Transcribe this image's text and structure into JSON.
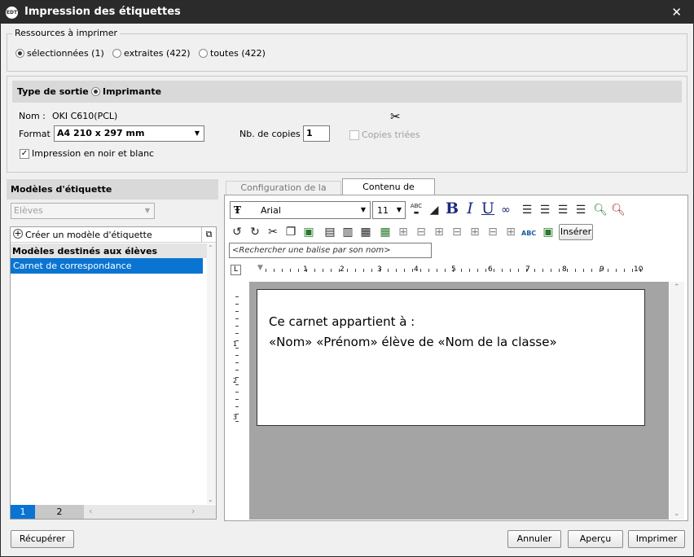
{
  "window": {
    "app_badge": "EDT",
    "title": "Impression des étiquettes"
  },
  "resources": {
    "legend": "Ressources à imprimer",
    "options": [
      "sélectionnées (1)",
      "extraites (422)",
      "toutes (422)"
    ],
    "selected_index": 0
  },
  "output": {
    "label": "Type de sortie :",
    "type": "Imprimante",
    "name_label": "Nom :",
    "name_value": "OKI C610(PCL)",
    "format_label": "Format :",
    "format_value": "A4 210 x 297 mm",
    "copies_label": "Nb. de copies :",
    "copies_value": "1",
    "sorted_label": "Copies triées",
    "bw_label": "Impression en noir et blanc",
    "bw_checked": true
  },
  "models": {
    "header": "Modèles d'étiquette",
    "category": "Elèves",
    "create_label": "Créer un modèle d'étiquette",
    "group_header": "Modèles destinés aux élèves",
    "items": [
      "Carnet de correspondance"
    ],
    "pages": [
      "1",
      "2"
    ]
  },
  "tabs": [
    "Configuration de la planche",
    "Contenu de l'étiquette"
  ],
  "editor": {
    "font": "Arial",
    "size": "11",
    "insert_label": "Insérer",
    "search_placeholder": "<Rechercher une balise par son nom>",
    "ruler_numbers": [
      "1",
      "2",
      "3",
      "4",
      "5",
      "6",
      "7",
      "8",
      "9",
      "10"
    ],
    "vruler_numbers": [
      "1",
      "2",
      "3"
    ],
    "line1": "Ce carnet appartient à :",
    "line2": "«Nom» «Prénom» élève de «Nom de la classe»"
  },
  "buttons": {
    "recover": "Récupérer",
    "cancel": "Annuler",
    "preview": "Aperçu",
    "print": "Imprimer"
  }
}
